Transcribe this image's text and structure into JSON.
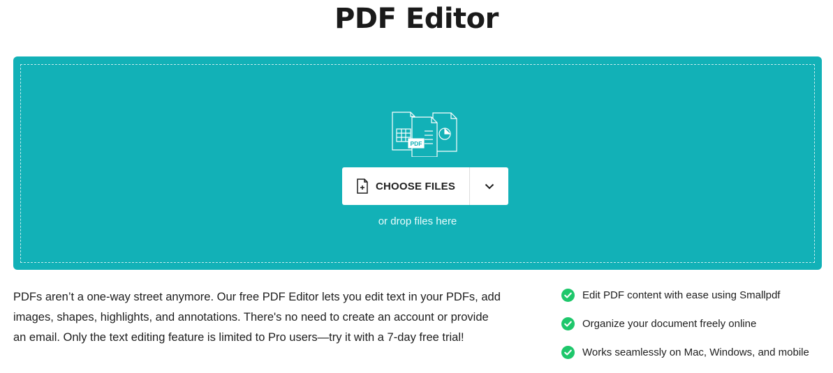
{
  "header": {
    "title": "PDF Editor"
  },
  "dropzone": {
    "illustration_icon": "pdf-files-illustration",
    "illustration_badge": "PDF",
    "choose_label": "CHOOSE FILES",
    "choose_icon": "file-add-icon",
    "dropdown_icon": "chevron-down-icon",
    "drop_hint": "or drop files here",
    "background_color": "#12b1b7"
  },
  "description": {
    "text": "PDFs aren’t a one-way street anymore. Our free PDF Editor lets you edit text in your PDFs, add images, shapes, highlights, and annotations. There's no need to create an account or provide an email. Only the text editing feature is limited to Pro users—try it with a 7-day free trial!"
  },
  "features": {
    "check_icon": "check-circle-icon",
    "check_color": "#1ec76b",
    "items": [
      {
        "label": "Edit PDF content with ease using Smallpdf"
      },
      {
        "label": "Organize your document freely online"
      },
      {
        "label": "Works seamlessly on Mac, Windows, and mobile"
      }
    ]
  }
}
